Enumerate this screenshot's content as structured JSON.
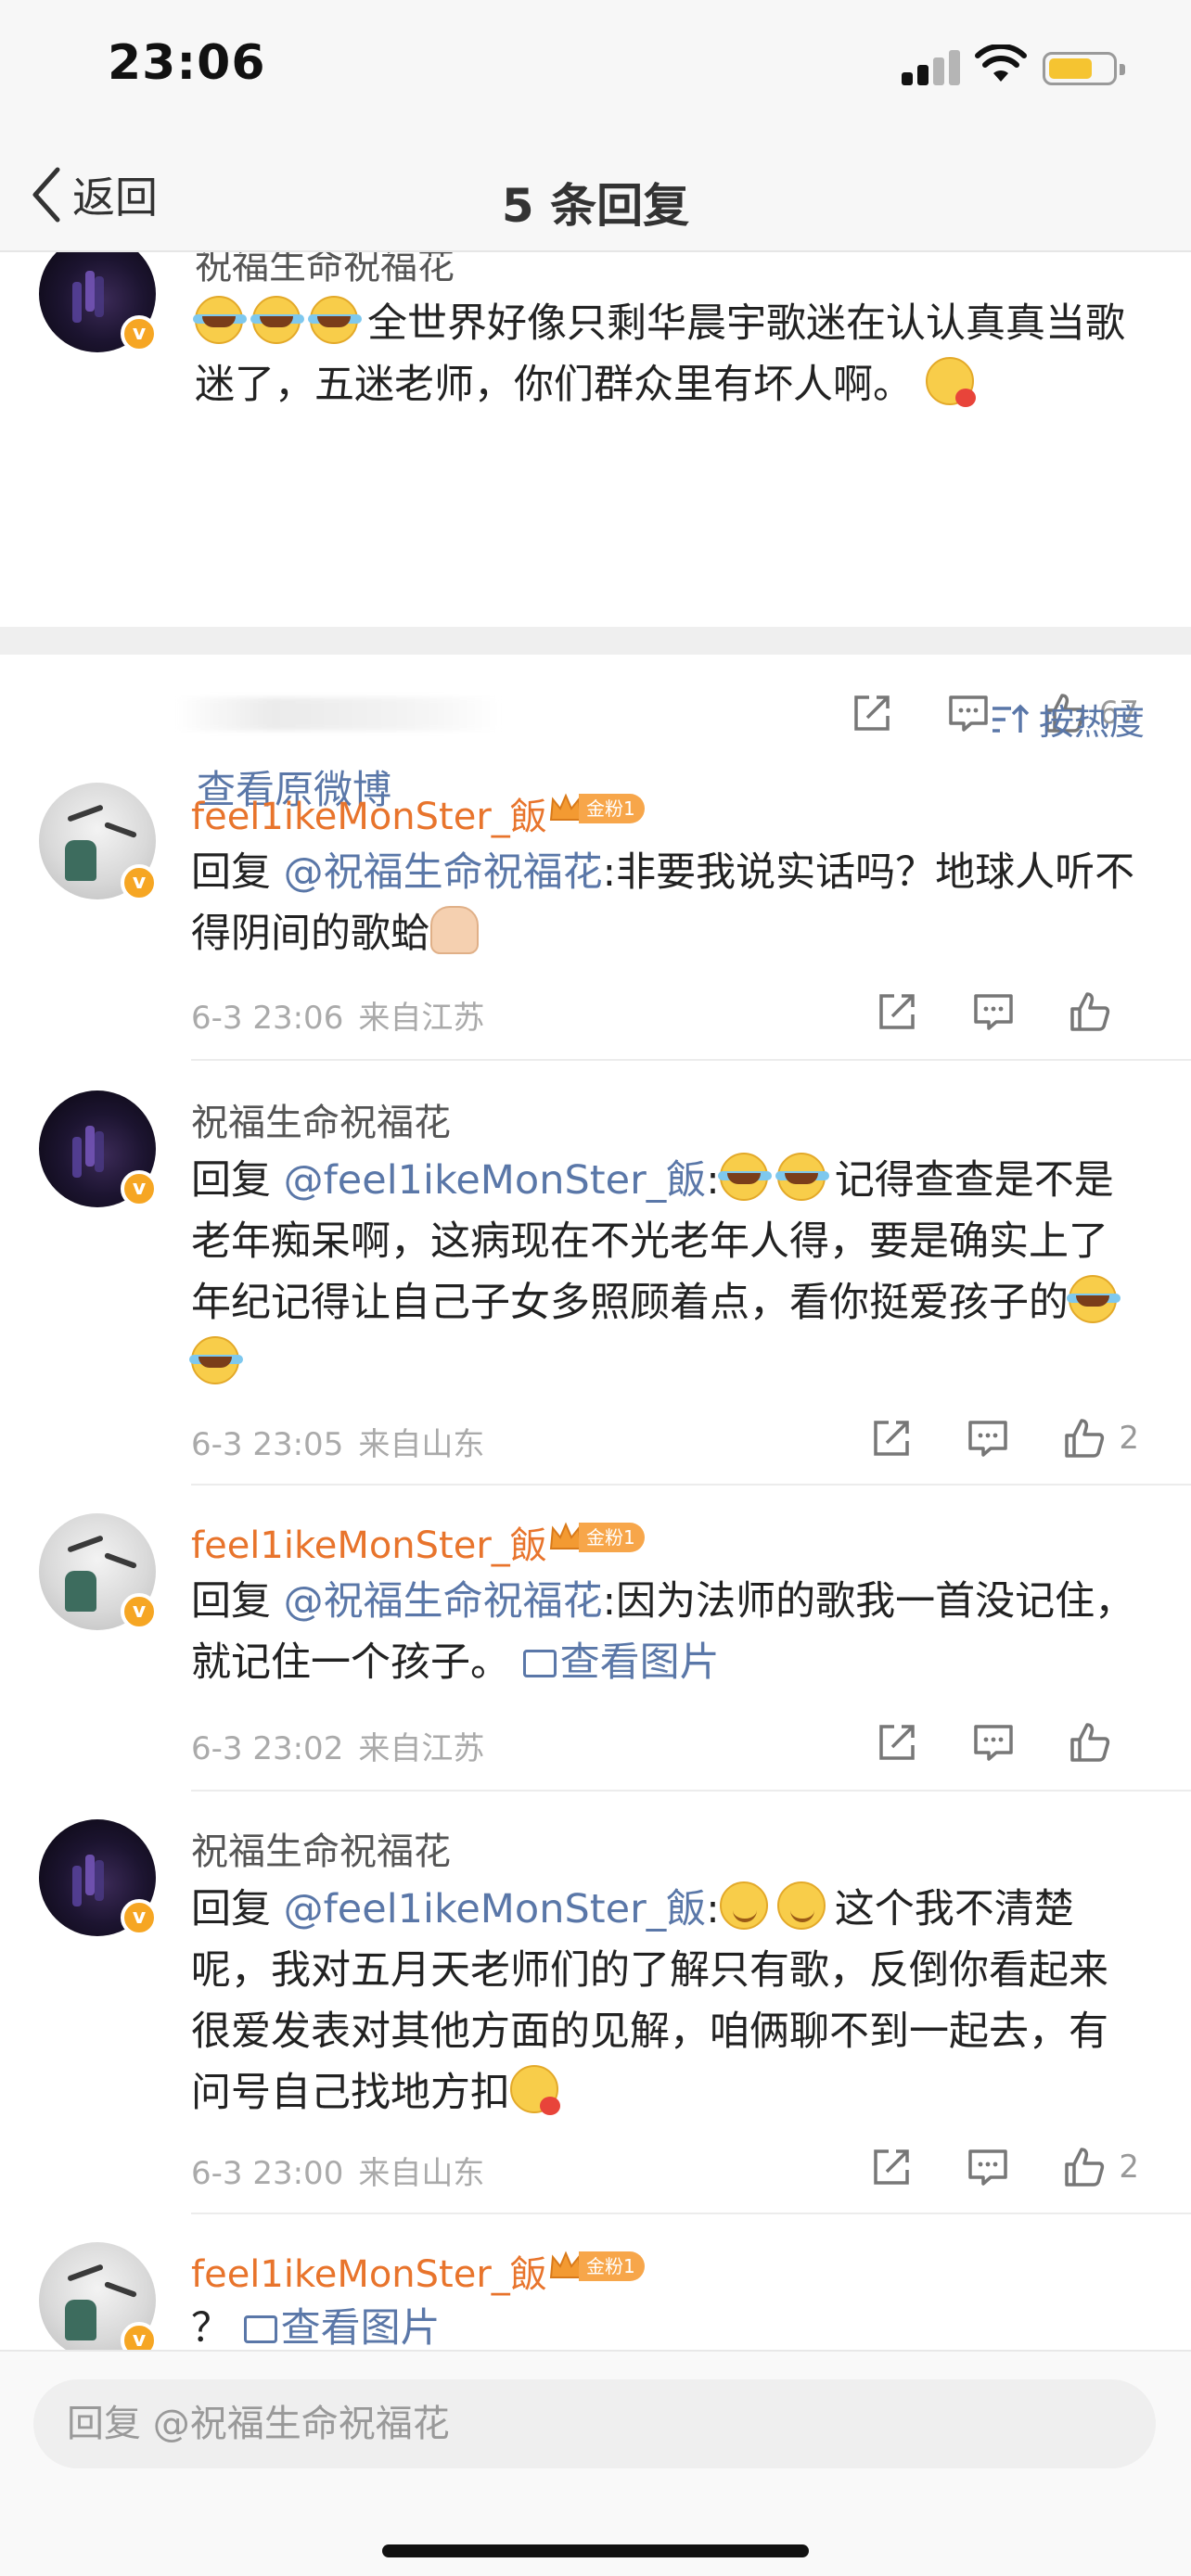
{
  "status_bar": {
    "time": "23:06"
  },
  "nav": {
    "back_label": "返回",
    "title": "5 条回复"
  },
  "root_comment": {
    "author": "祝福生命祝福花",
    "text": "全世界好像只剩华晨宇歌迷在认认真真当歌迷了，五迷老师，你们群众里有坏人啊。",
    "like_count": "67",
    "view_original": "查看原微博"
  },
  "sort": {
    "label": "按热度"
  },
  "replies": [
    {
      "author": "feel1ikeMonSter_飯",
      "fan_badge": "金粉1",
      "prefix": "回复 ",
      "mention": "@祝福生命祝福花",
      "text": ":非要我说实话吗？地球人听不得阴间的歌蛤",
      "date": "6-3 23:06",
      "location": "来自江苏",
      "like_count": ""
    },
    {
      "author": "祝福生命祝福花",
      "prefix": "回复 ",
      "mention": "@feel1ikeMonSter_飯",
      "text_a": "记得查查是不是老年痴呆啊，这病现在不光老年人得，要是确实上了年纪记得让自己子女多照顾着点，看你挺爱孩子的",
      "date": "6-3 23:05",
      "location": "来自山东",
      "like_count": "2"
    },
    {
      "author": "feel1ikeMonSter_飯",
      "fan_badge": "金粉1",
      "prefix": "回复 ",
      "mention": "@祝福生命祝福花",
      "text": ":因为法师的歌我一首没记住，就记住一个孩子。",
      "view_image": "查看图片",
      "date": "6-3 23:02",
      "location": "来自江苏",
      "like_count": ""
    },
    {
      "author": "祝福生命祝福花",
      "prefix": "回复 ",
      "mention": "@feel1ikeMonSter_飯",
      "text": "这个我不清楚呢，我对五月天老师们的了解只有歌，反倒你看起来很爱发表对其他方面的见解，咱俩聊不到一起去，有问号自己找地方扣",
      "date": "6-3 23:00",
      "location": "来自山东",
      "like_count": "2"
    },
    {
      "author": "feel1ikeMonSter_飯",
      "fan_badge": "金粉1",
      "text": "？",
      "view_image": "查看图片"
    }
  ],
  "reply_input": {
    "placeholder": "回复 @祝福生命祝福花"
  },
  "icons": {
    "back": "chevron-left-icon",
    "repost": "share-icon",
    "comment": "comment-icon",
    "like": "thumb-up-icon",
    "sort": "sort-icon",
    "image": "image-icon",
    "verified": "verified-badge-icon",
    "crown": "crown-icon"
  },
  "colors": {
    "link": "#5a77a8",
    "vip_name": "#e8742c",
    "badge": "#f7a64a",
    "verified": "#f6a623"
  }
}
